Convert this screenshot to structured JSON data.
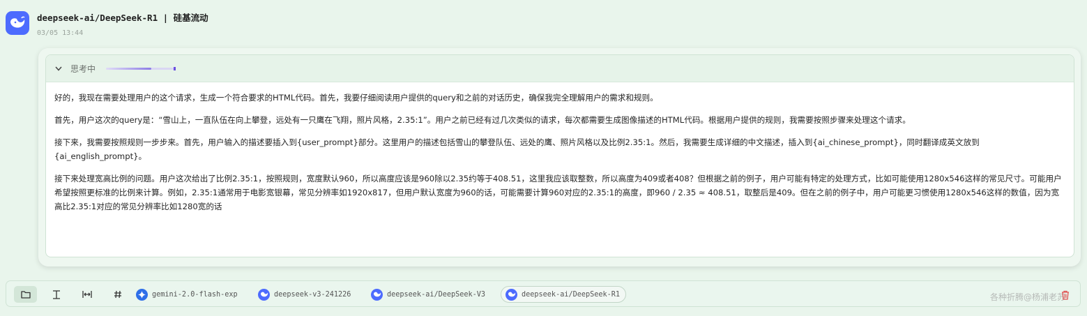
{
  "header": {
    "model_title": "deepseek-ai/DeepSeek-R1 | 硅基流动",
    "timestamp": "03/05 13:44"
  },
  "thinking": {
    "label": "思考中",
    "progress": 0.65,
    "paragraphs": [
      "好的，我现在需要处理用户的这个请求，生成一个符合要求的HTML代码。首先，我要仔细阅读用户提供的query和之前的对话历史，确保我完全理解用户的需求和规则。",
      "首先，用户这次的query是：“雪山上，一直队伍在向上攀登，远处有一只鹰在飞翔，照片风格，2.35:1”。用户之前已经有过几次类似的请求，每次都需要生成图像描述的HTML代码。根据用户提供的规则，我需要按照步骤来处理这个请求。",
      "接下来，我需要按照规则一步步来。首先，用户输入的描述要插入到{user_prompt}部分。这里用户的描述包括雪山的攀登队伍、远处的鹰、照片风格以及比例2.35:1。然后，我需要生成详细的中文描述，插入到{ai_chinese_prompt}，同时翻译成英文放到{ai_english_prompt}。",
      "接下来处理宽高比例的问题。用户这次给出了比例2.35:1，按照规则，宽度默认960，所以高度应该是960除以2.35约等于408.51，这里我应该取整数，所以高度为409或者408？但根据之前的例子，用户可能有特定的处理方式，比如可能使用1280x546这样的常见尺寸。可能用户希望按照更标准的比例来计算。例如，2.35:1通常用于电影宽银幕，常见分辨率如1920x817，但用户默认宽度为960的话，可能需要计算960对应的2.35:1的高度，即960 / 2.35 ≈ 408.51，取整后是409。但在之前的例子中，用户可能更习惯使用1280x546这样的数值，因为宽高比2.35:1对应的常见分辨率比如1280宽的话"
    ]
  },
  "toolbar": {
    "tools": [
      {
        "name": "folder",
        "icon": "folder-icon",
        "active": true
      },
      {
        "name": "text-height",
        "icon": "text-height-icon",
        "active": false
      },
      {
        "name": "width",
        "icon": "width-icon",
        "active": false
      },
      {
        "name": "hash",
        "icon": "hash-icon",
        "active": false
      }
    ],
    "models": [
      {
        "label": "gemini-2.0-flash-exp",
        "icon": "gemini-icon",
        "color": "#2f6fe8",
        "selected": false
      },
      {
        "label": "deepseek-v3-241226",
        "icon": "deepseek-icon",
        "color": "#4d6bfe",
        "selected": false
      },
      {
        "label": "deepseek-ai/DeepSeek-V3",
        "icon": "deepseek-icon",
        "color": "#4d6bfe",
        "selected": false
      },
      {
        "label": "deepseek-ai/DeepSeek-R1",
        "icon": "deepseek-icon",
        "color": "#4d6bfe",
        "selected": true
      }
    ]
  },
  "watermark": "各种折腾@杨浦老苏",
  "colors": {
    "background": "#e9f5ec",
    "accent": "#4d6bfe",
    "progress": "#6b4fe0",
    "trash": "#e05252"
  }
}
